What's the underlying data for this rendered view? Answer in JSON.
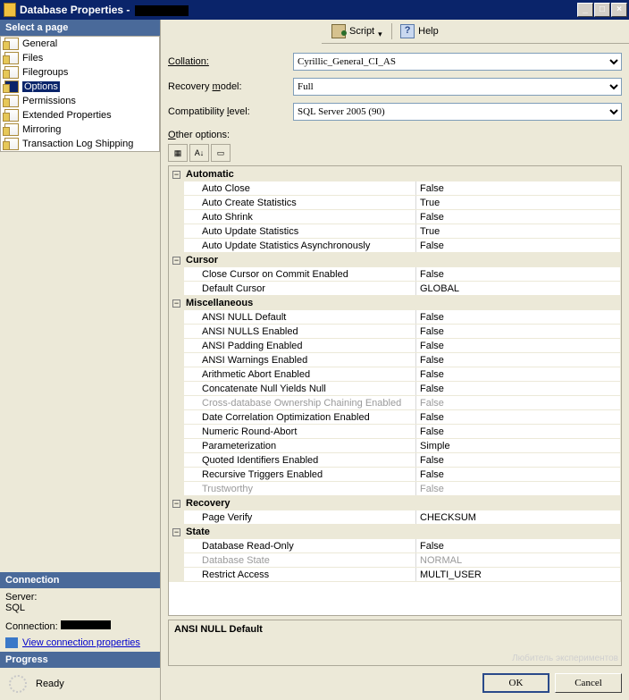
{
  "title": "Database Properties - ",
  "winbtns": {
    "min": "_",
    "max": "□",
    "close": "×"
  },
  "toolbar": {
    "script": "Script",
    "help": "Help"
  },
  "sidebar": {
    "header": "Select a page",
    "items": [
      {
        "label": "General"
      },
      {
        "label": "Files"
      },
      {
        "label": "Filegroups"
      },
      {
        "label": "Options",
        "selected": true
      },
      {
        "label": "Permissions"
      },
      {
        "label": "Extended Properties"
      },
      {
        "label": "Mirroring"
      },
      {
        "label": "Transaction Log Shipping"
      }
    ],
    "connection": {
      "header": "Connection",
      "server_label": "Server:",
      "server_value": "SQL",
      "conn_label": "Connection:",
      "link": "View connection properties"
    },
    "progress": {
      "header": "Progress",
      "status": "Ready"
    }
  },
  "form": {
    "collation": {
      "label": "Collation:",
      "value": "Cyrillic_General_CI_AS"
    },
    "recovery": {
      "label": "Recovery model:",
      "value": "Full"
    },
    "compat": {
      "label": "Compatibility level:",
      "value": "SQL Server 2005 (90)"
    },
    "other": "Other options:"
  },
  "grid": {
    "categories": [
      {
        "name": "Automatic",
        "rows": [
          {
            "k": "Auto Close",
            "v": "False"
          },
          {
            "k": "Auto Create Statistics",
            "v": "True"
          },
          {
            "k": "Auto Shrink",
            "v": "False"
          },
          {
            "k": "Auto Update Statistics",
            "v": "True"
          },
          {
            "k": "Auto Update Statistics Asynchronously",
            "v": "False"
          }
        ]
      },
      {
        "name": "Cursor",
        "rows": [
          {
            "k": "Close Cursor on Commit Enabled",
            "v": "False"
          },
          {
            "k": "Default Cursor",
            "v": "GLOBAL"
          }
        ]
      },
      {
        "name": "Miscellaneous",
        "rows": [
          {
            "k": "ANSI NULL Default",
            "v": "False"
          },
          {
            "k": "ANSI NULLS Enabled",
            "v": "False"
          },
          {
            "k": "ANSI Padding Enabled",
            "v": "False"
          },
          {
            "k": "ANSI Warnings Enabled",
            "v": "False"
          },
          {
            "k": "Arithmetic Abort Enabled",
            "v": "False"
          },
          {
            "k": "Concatenate Null Yields Null",
            "v": "False"
          },
          {
            "k": "Cross-database Ownership Chaining Enabled",
            "v": "False",
            "disabled": true
          },
          {
            "k": "Date Correlation Optimization Enabled",
            "v": "False"
          },
          {
            "k": "Numeric Round-Abort",
            "v": "False"
          },
          {
            "k": "Parameterization",
            "v": "Simple"
          },
          {
            "k": "Quoted Identifiers Enabled",
            "v": "False"
          },
          {
            "k": "Recursive Triggers Enabled",
            "v": "False"
          },
          {
            "k": "Trustworthy",
            "v": "False",
            "disabled": true
          }
        ]
      },
      {
        "name": "Recovery",
        "rows": [
          {
            "k": "Page Verify",
            "v": "CHECKSUM"
          }
        ]
      },
      {
        "name": "State",
        "rows": [
          {
            "k": "Database Read-Only",
            "v": "False"
          },
          {
            "k": "Database State",
            "v": "NORMAL",
            "disabled": true
          },
          {
            "k": "Restrict Access",
            "v": "MULTI_USER"
          }
        ]
      }
    ],
    "description": "ANSI NULL Default"
  },
  "footer": {
    "ok": "OK",
    "cancel": "Cancel"
  },
  "watermark": "Любитель\nэкспериментов"
}
